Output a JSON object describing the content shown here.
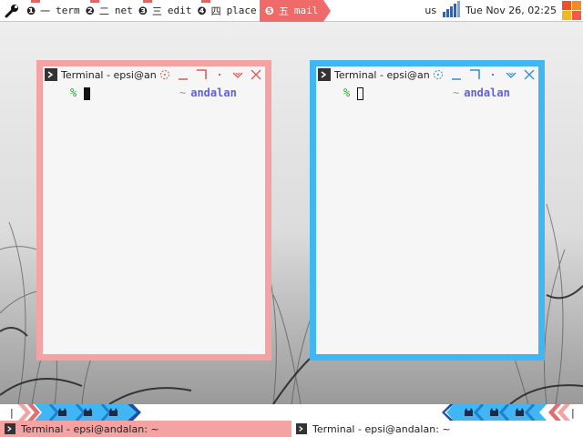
{
  "topbar": {
    "tags": [
      {
        "num": "❶",
        "cjk": "一",
        "label": "term"
      },
      {
        "num": "❷",
        "cjk": "二",
        "label": "net"
      },
      {
        "num": "❸",
        "cjk": "三",
        "label": "edit"
      },
      {
        "num": "❹",
        "cjk": "四",
        "label": "place"
      },
      {
        "num": "❺",
        "cjk": "五",
        "label": "mail"
      }
    ],
    "keyboard_layout": "us",
    "datetime": "Tue Nov 26, 02:25",
    "accent_color": "#f06a6a"
  },
  "windows": [
    {
      "title": "Terminal - epsi@an...",
      "prompt": "%",
      "tilde": "~",
      "host": "andalan",
      "border_color": "#f4a2a2",
      "focused": true
    },
    {
      "title": "Terminal - epsi@an...",
      "prompt": "%",
      "tilde": "~",
      "host": "andalan",
      "border_color": "#41b6f5",
      "focused": false
    }
  ],
  "bottombar": {
    "left_marker": "|",
    "right_marker": "|"
  },
  "taskbar": {
    "tasks": [
      {
        "label": "Terminal - epsi@andalan: ~"
      },
      {
        "label": "Terminal - epsi@andalan: ~"
      }
    ]
  },
  "icons": {
    "launcher": "wrench-icon",
    "app": "terminal-icon",
    "network": "signal-bars-icon",
    "layout": "tiles-icon"
  }
}
